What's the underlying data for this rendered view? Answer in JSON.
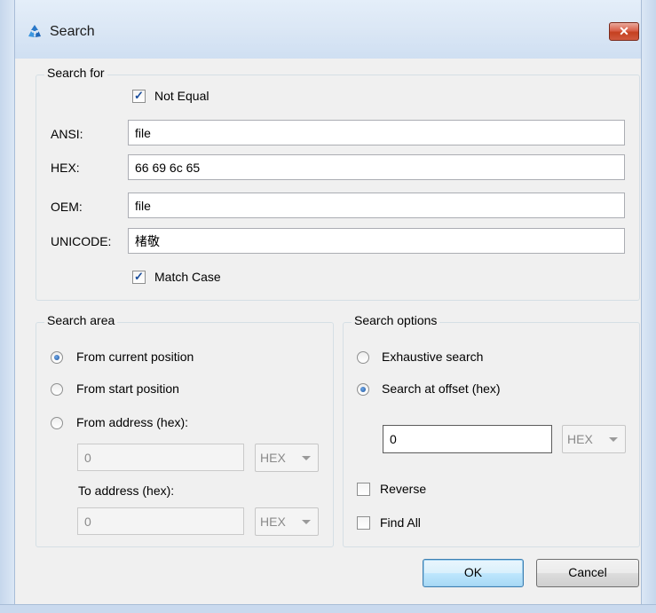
{
  "window": {
    "title": "Search",
    "app_icon": "recycle-arrows-icon",
    "close_glyph": "✕"
  },
  "search_for": {
    "legend": "Search for",
    "not_equal": {
      "label": "Not Equal",
      "checked": true
    },
    "ansi": {
      "label": "ANSI:",
      "value": "file"
    },
    "hex": {
      "label": "HEX:",
      "value": "66 69 6c 65"
    },
    "oem": {
      "label": "OEM:",
      "value": "file"
    },
    "unicode": {
      "label": "UNICODE:",
      "value": "楮敬"
    },
    "match_case": {
      "label": "Match Case",
      "checked": true
    }
  },
  "search_area": {
    "legend": "Search area",
    "options": [
      {
        "label": "From current position",
        "selected": true
      },
      {
        "label": "From start position",
        "selected": false
      },
      {
        "label": "From address (hex):",
        "selected": false
      }
    ],
    "from_address": {
      "value": "0",
      "format": "HEX"
    },
    "to_address_label": "To address (hex):",
    "to_address": {
      "value": "0",
      "format": "HEX"
    }
  },
  "search_options": {
    "legend": "Search options",
    "options": [
      {
        "label": "Exhaustive search",
        "selected": false
      },
      {
        "label": "Search at offset (hex)",
        "selected": true
      }
    ],
    "offset": {
      "value": "0",
      "format": "HEX"
    },
    "reverse": {
      "label": "Reverse",
      "checked": false
    },
    "find_all": {
      "label": "Find All",
      "checked": false
    }
  },
  "buttons": {
    "ok": "OK",
    "cancel": "Cancel"
  },
  "colors": {
    "accent_radio": "#1b4f9a",
    "checkmark": "#1a4e9c",
    "close_red": "#c5401f"
  }
}
